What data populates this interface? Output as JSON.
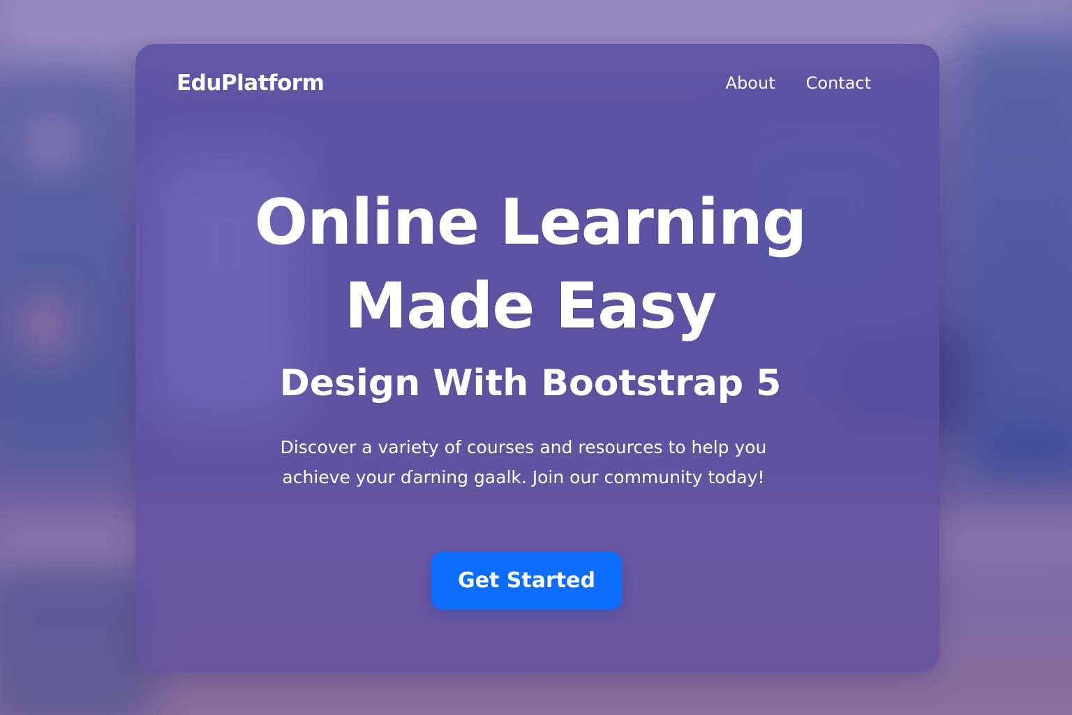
{
  "header": {
    "brand": "EduPlatform",
    "nav": [
      {
        "label": "About"
      },
      {
        "label": "Contact"
      }
    ]
  },
  "hero": {
    "title_line1": "Online Learning",
    "title_line2": "Made Easy",
    "subtitle": "Design With Bootstrap 5",
    "description": "Discover a variety of courses and resources to help you achieve your ɗarning gaalk. Join our community today!",
    "cta_label": "Get Started"
  },
  "colors": {
    "accent": "#0d6efd",
    "card": "#5c50a2",
    "text": "#ffffff"
  }
}
